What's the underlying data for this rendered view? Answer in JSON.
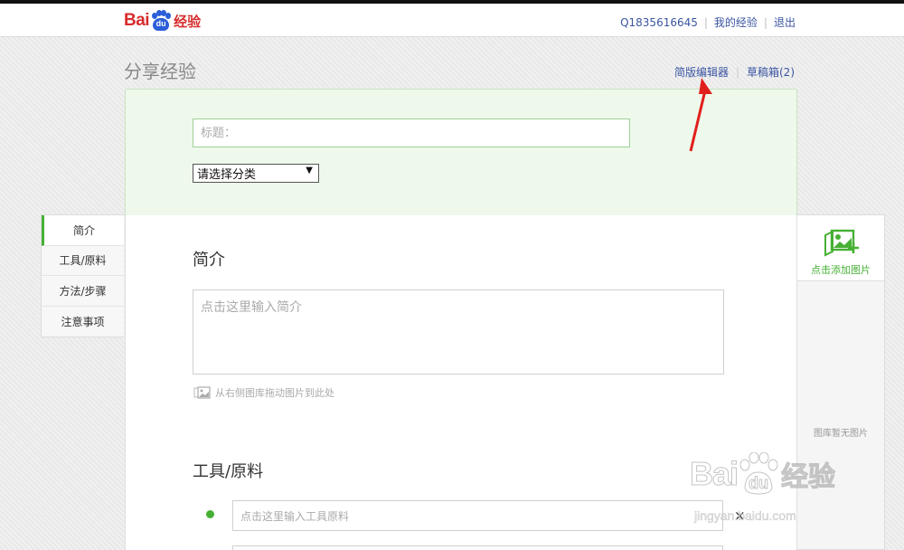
{
  "header": {
    "logo_text": "Bai",
    "logo_paw_text": "du",
    "logo_suffix": "经验",
    "user_id": "Q1835616645",
    "my_experience": "我的经验",
    "logout": "退出"
  },
  "page": {
    "title": "分享经验",
    "simple_editor_link": "简版编辑器",
    "drafts_link": "草稿箱(2)"
  },
  "form": {
    "title_placeholder": "标题：",
    "category_selected": "请选择分类"
  },
  "left_nav": {
    "items": [
      {
        "label": "简介"
      },
      {
        "label": "工具/原料"
      },
      {
        "label": "方法/步骤"
      },
      {
        "label": "注意事项"
      }
    ]
  },
  "sections": {
    "intro_title": "简介",
    "intro_placeholder": "点击这里输入简介",
    "drag_hint": "从右侧图库拖动图片到此处",
    "tools_title": "工具/原料",
    "tool_placeholder": "点击这里输入工具原料",
    "remove_symbol": "×"
  },
  "right_panel": {
    "add_image_label": "点击添加图片",
    "gallery_empty": "图库暂无图片"
  },
  "watermark": {
    "brand_text": "Bai",
    "brand_paw_text": "du",
    "brand_suffix": "经验",
    "url": "jingyan.baidu.com"
  },
  "colors": {
    "accent_green": "#46b035",
    "brand_red": "#d72c2c",
    "brand_blue": "#2b5ed8",
    "link_blue": "#3a55a2",
    "annotation_red": "#e0201b"
  }
}
